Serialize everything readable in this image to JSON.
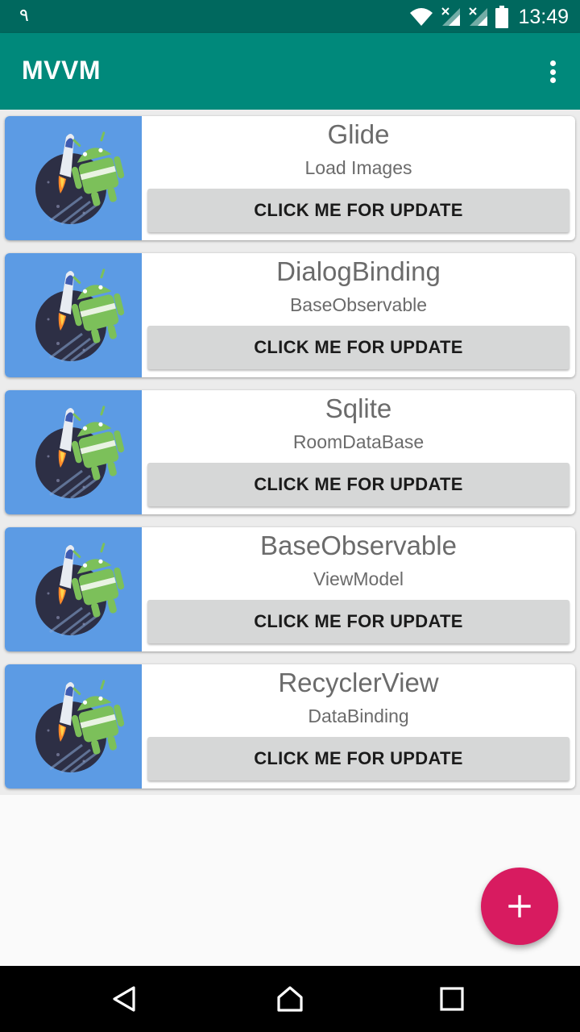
{
  "status_bar": {
    "left_glyph": "٩",
    "time": "13:49",
    "icons": [
      "wifi-icon",
      "signal-icon",
      "signal-icon",
      "battery-icon"
    ]
  },
  "app_bar": {
    "title": "MVVM",
    "menu_icon": "overflow-menu-icon"
  },
  "cards": [
    {
      "title": "Glide",
      "subtitle": "Load Images",
      "button": "CLICK ME FOR UPDATE",
      "image": "android-rocket-image"
    },
    {
      "title": "DialogBinding",
      "subtitle": "BaseObservable",
      "button": "CLICK ME FOR UPDATE",
      "image": "android-rocket-image"
    },
    {
      "title": "Sqlite",
      "subtitle": "RoomDataBase",
      "button": "CLICK ME FOR UPDATE",
      "image": "android-rocket-image"
    },
    {
      "title": "BaseObservable",
      "subtitle": "ViewModel",
      "button": "CLICK ME FOR UPDATE",
      "image": "android-rocket-image"
    },
    {
      "title": "RecyclerView",
      "subtitle": "DataBinding",
      "button": "CLICK ME FOR UPDATE",
      "image": "android-rocket-image"
    }
  ],
  "fab": {
    "icon": "plus-icon"
  },
  "nav_bar": {
    "buttons": [
      "back-icon",
      "home-icon",
      "recents-icon"
    ]
  },
  "colors": {
    "status_bar": "#00685e",
    "app_bar": "#00897b",
    "fab": "#d81b60",
    "card_image_bg": "#5c9be4",
    "button_bg": "#d6d7d7"
  }
}
